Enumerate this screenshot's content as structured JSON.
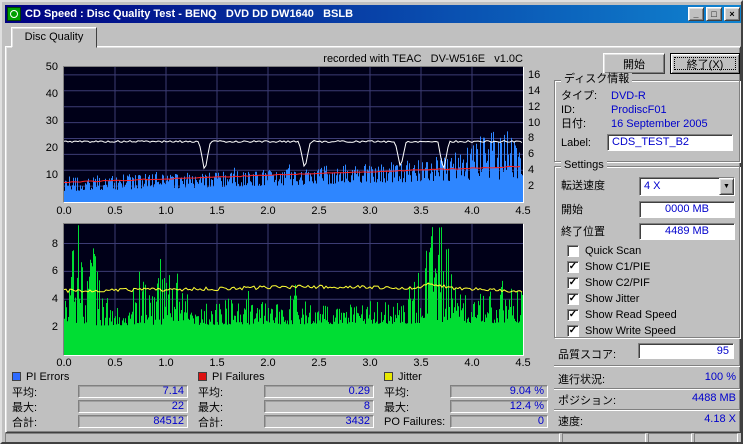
{
  "window": {
    "title": "CD Speed : Disc Quality Test - BENQ   DVD DD DW1640   BSLB",
    "tab_label": "Disc Quality",
    "recorded_note": "recorded with TEAC   DV-W516E   v1.0C"
  },
  "icons": {
    "minimize": "_",
    "maximize": "□",
    "close": "×",
    "dropdown": "▼",
    "check": "✓"
  },
  "actions": {
    "start": "開始",
    "exit": "終了(X)"
  },
  "disc_info": {
    "title": "ディスク情報",
    "type_label": "タイプ:",
    "type_value": "DVD-R",
    "id_label": "ID:",
    "id_value": "ProdiscF01",
    "date_label": "日付:",
    "date_value": "16 September 2005",
    "label_label": "Label:",
    "label_value": "CDS_TEST_B2"
  },
  "settings": {
    "title": "Settings",
    "speed_label": "転送速度",
    "speed_value": "4 X",
    "start_label": "開始",
    "start_value": "0000 MB",
    "end_label": "終了位置",
    "end_value": "4489 MB",
    "checkboxes": [
      {
        "label": "Quick Scan",
        "checked": false
      },
      {
        "label": "Show C1/PIE",
        "checked": true
      },
      {
        "label": "Show C2/PIF",
        "checked": true
      },
      {
        "label": "Show Jitter",
        "checked": true
      },
      {
        "label": "Show Read Speed",
        "checked": true
      },
      {
        "label": "Show Write Speed",
        "checked": true
      }
    ]
  },
  "quality_score": {
    "label": "品質スコア:",
    "value": "95"
  },
  "progress": {
    "rows": [
      {
        "label": "進行状況:",
        "value": "100 %"
      },
      {
        "label": "ポジション:",
        "value": "4488 MB"
      },
      {
        "label": "速度:",
        "value": "4.18 X"
      }
    ]
  },
  "stats": {
    "groups": [
      {
        "name": "PI Errors",
        "color": "#2e6bff",
        "rows": [
          {
            "label": "平均:",
            "value": "7.14"
          },
          {
            "label": "最大:",
            "value": "22"
          },
          {
            "label": "合計:",
            "value": "84512"
          }
        ]
      },
      {
        "name": "PI Failures",
        "color": "#dd1111",
        "rows": [
          {
            "label": "平均:",
            "value": "0.29"
          },
          {
            "label": "最大:",
            "value": "8"
          },
          {
            "label": "合計:",
            "value": "3432"
          }
        ]
      },
      {
        "name": "Jitter",
        "color": "#e8e800",
        "rows": [
          {
            "label": "平均:",
            "value": "9.04 %"
          },
          {
            "label": "最大:",
            "value": "12.4 %"
          },
          {
            "label": "PO Failures:",
            "value": "0"
          }
        ]
      }
    ]
  },
  "chart_data": {
    "x_range": [
      0,
      4.5
    ],
    "x_ticks": [
      "0.0",
      "0.5",
      "1.0",
      "1.5",
      "2.0",
      "2.5",
      "3.0",
      "3.5",
      "4.0",
      "4.5"
    ],
    "style": {
      "bg": "#000018",
      "grid": "#3c3c74"
    },
    "top": {
      "type": "area",
      "left_ticks": [
        "50",
        "40",
        "30",
        "20",
        "10"
      ],
      "left_range": [
        0,
        50
      ],
      "right_ticks": [
        "16",
        "14",
        "12",
        "10",
        "8",
        "6",
        "4",
        "2"
      ],
      "right_range": [
        0,
        17
      ],
      "series": [
        {
          "name": "PI Errors",
          "style": "spikes",
          "color": "#2e86ff",
          "base": [
            [
              0,
              4
            ],
            [
              4.5,
              8.5
            ]
          ],
          "envelope": [
            [
              0,
              9
            ],
            [
              1,
              10.5
            ],
            [
              2,
              12
            ],
            [
              3,
              13.5
            ],
            [
              3.5,
              15
            ],
            [
              3.9,
              18
            ],
            [
              4.1,
              26
            ],
            [
              4.35,
              25
            ],
            [
              4.5,
              20
            ]
          ]
        },
        {
          "name": "Write Speed",
          "style": "line",
          "color": "#ff2222",
          "points": [
            [
              0,
              7.3
            ],
            [
              4.5,
              13.2
            ]
          ]
        },
        {
          "name": "Read Speed",
          "style": "line-with-dips",
          "color": "#ffffff",
          "level": 22.4,
          "dips": [
            [
              1.38,
              11
            ],
            [
              2.36,
              12
            ],
            [
              3.3,
              12.5
            ],
            [
              3.72,
              11.5
            ]
          ]
        }
      ]
    },
    "bottom": {
      "type": "area",
      "left_ticks": [
        "8",
        "6",
        "4",
        "2"
      ],
      "left_range": [
        0,
        9.4
      ],
      "series": [
        {
          "name": "PI Failures",
          "style": "spikes",
          "color": "#00dd33",
          "base": [
            [
              0,
              2.1
            ],
            [
              4.5,
              2.3
            ]
          ],
          "envelope": [
            [
              0,
              3.5
            ],
            [
              0.08,
              8.5
            ],
            [
              0.14,
              9.2
            ],
            [
              0.2,
              4.5
            ],
            [
              0.27,
              9.2
            ],
            [
              0.34,
              5
            ],
            [
              0.5,
              3.5
            ],
            [
              0.8,
              6
            ],
            [
              0.95,
              7.2
            ],
            [
              1.1,
              6
            ],
            [
              1.25,
              4
            ],
            [
              1.6,
              4.2
            ],
            [
              2.0,
              3.8
            ],
            [
              2.3,
              4.6
            ],
            [
              2.6,
              3.6
            ],
            [
              3.0,
              4
            ],
            [
              3.3,
              3.6
            ],
            [
              3.5,
              6.5
            ],
            [
              3.62,
              9.3
            ],
            [
              3.72,
              8.6
            ],
            [
              3.85,
              5
            ],
            [
              4.05,
              4.2
            ],
            [
              4.25,
              5.6
            ],
            [
              4.5,
              4.5
            ]
          ]
        },
        {
          "name": "Jitter",
          "style": "noisy-line",
          "color": "#ffff33",
          "noise": 0.13,
          "points": [
            [
              0,
              4.6
            ],
            [
              0.5,
              4.65
            ],
            [
              1,
              4.7
            ],
            [
              1.5,
              4.75
            ],
            [
              2,
              4.85
            ],
            [
              2.5,
              4.9
            ],
            [
              3,
              4.85
            ],
            [
              3.4,
              4.8
            ],
            [
              3.6,
              5.1
            ],
            [
              3.8,
              4.8
            ],
            [
              4.2,
              4.65
            ],
            [
              4.5,
              4.55
            ]
          ]
        }
      ]
    }
  }
}
